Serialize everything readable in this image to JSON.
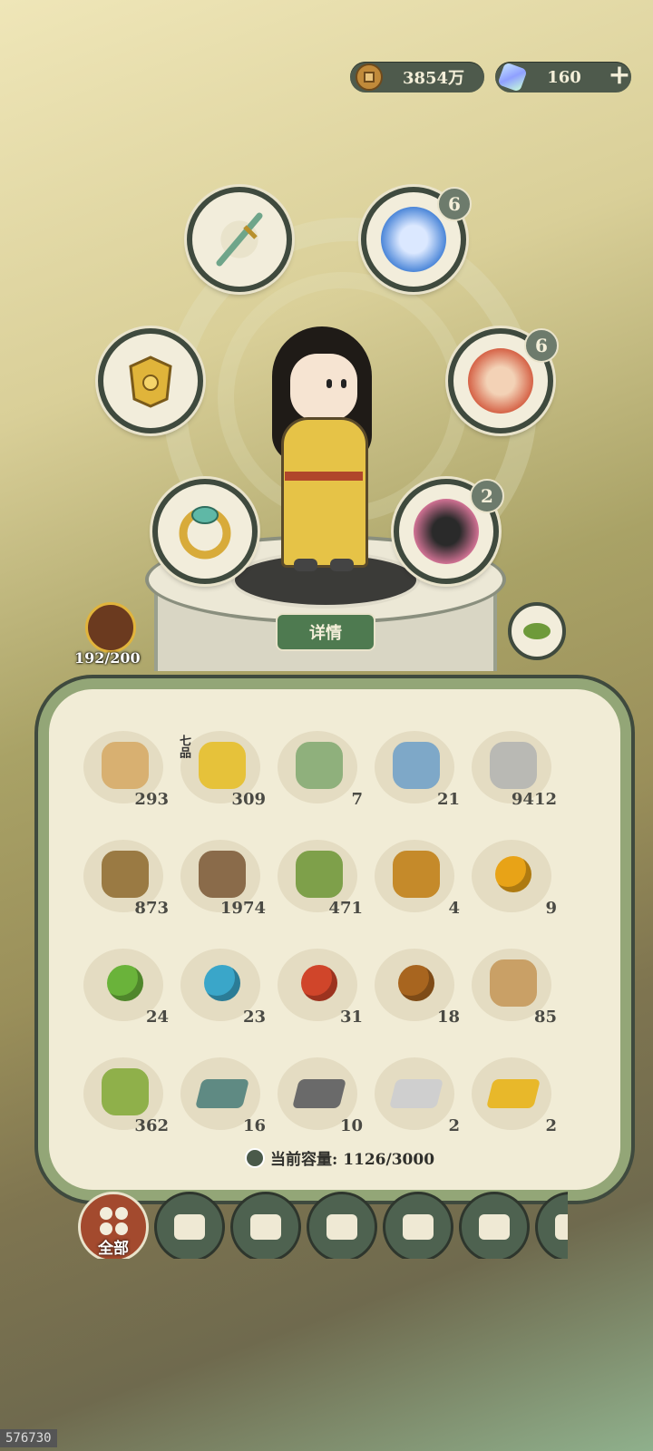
{
  "currency": {
    "coins": "3854万",
    "coins_icon": "copper-coin-icon",
    "gems": "160",
    "gems_icon": "jade-gem-icon",
    "add": "+"
  },
  "equipment": [
    {
      "id": "sword",
      "icon": "jade-sword-icon",
      "badge": ""
    },
    {
      "id": "armor",
      "icon": "golden-armor-icon",
      "badge": ""
    },
    {
      "id": "ring",
      "icon": "jade-ring-icon",
      "badge": ""
    },
    {
      "id": "companion_blue",
      "icon": "blue-spirit-icon",
      "badge": "6"
    },
    {
      "id": "companion_red",
      "icon": "official-portrait-icon",
      "badge": "6"
    },
    {
      "id": "companion_dragon",
      "icon": "dragon-spirit-icon",
      "badge": "2"
    }
  ],
  "detail_label": "详情",
  "stamina": "192/200",
  "inventory": {
    "grade_label": "七品",
    "items": [
      {
        "icon": "scroll-icon",
        "color": "#d8b071",
        "count": "293"
      },
      {
        "icon": "golden-fruit-icon",
        "color": "#e6c23a",
        "count": "309"
      },
      {
        "icon": "green-pouch-icon",
        "color": "#8fb07c",
        "count": "7"
      },
      {
        "icon": "blue-pouch-icon",
        "color": "#7ea8c8",
        "count": "21"
      },
      {
        "icon": "stone-icon",
        "color": "#b9b9b4",
        "count": "9412"
      },
      {
        "icon": "straw-bundle-icon",
        "color": "#9a7a43",
        "count": "873"
      },
      {
        "icon": "log-icon",
        "color": "#8a6b4a",
        "count": "1974"
      },
      {
        "icon": "bamboo-icon",
        "color": "#7ea04a",
        "count": "471"
      },
      {
        "icon": "herb-flower-icon",
        "color": "#c58a2a",
        "count": "4"
      },
      {
        "icon": "gold-orb-icon",
        "color": "#e8a317",
        "count": "9"
      },
      {
        "icon": "green-orb-icon",
        "color": "#6ab33a",
        "count": "24"
      },
      {
        "icon": "cyan-orb-icon",
        "color": "#3aa6c9",
        "count": "23"
      },
      {
        "icon": "red-orb-icon",
        "color": "#d0452a",
        "count": "31"
      },
      {
        "icon": "bronze-orb-icon",
        "color": "#a8651f",
        "count": "18"
      },
      {
        "icon": "wood-plank-icon",
        "color": "#c9a066",
        "count": "85"
      },
      {
        "icon": "bamboo-strips-icon",
        "color": "#8fb04a",
        "count": "362"
      },
      {
        "icon": "jade-ingot-icon",
        "color": "#5f8a83",
        "count": "16"
      },
      {
        "icon": "iron-ingot-icon",
        "color": "#6a6a6a",
        "count": "10"
      },
      {
        "icon": "silver-ingot-icon",
        "color": "#cfcfcf",
        "count": "2"
      },
      {
        "icon": "gold-ingot-icon",
        "color": "#e8b82a",
        "count": "2"
      }
    ],
    "capacity": "当前容量: 1126/3000"
  },
  "tabs": [
    {
      "icon": "all-grid-icon",
      "label": "全部",
      "active": true
    },
    {
      "icon": "log-tab-icon",
      "label": "",
      "active": false
    },
    {
      "icon": "house-tab-icon",
      "label": "",
      "active": false
    },
    {
      "icon": "herb-tab-icon",
      "label": "",
      "active": false
    },
    {
      "icon": "rice-bowl-tab-icon",
      "label": "",
      "active": false
    },
    {
      "icon": "ore-tab-icon",
      "label": "",
      "active": false
    },
    {
      "icon": "scroll-tab-icon",
      "label": "",
      "active": false
    }
  ],
  "uid": "576730",
  "colors": {
    "panel_border": "#93a677",
    "dark_green": "#4e6250",
    "active_tab": "#a34a2e"
  }
}
